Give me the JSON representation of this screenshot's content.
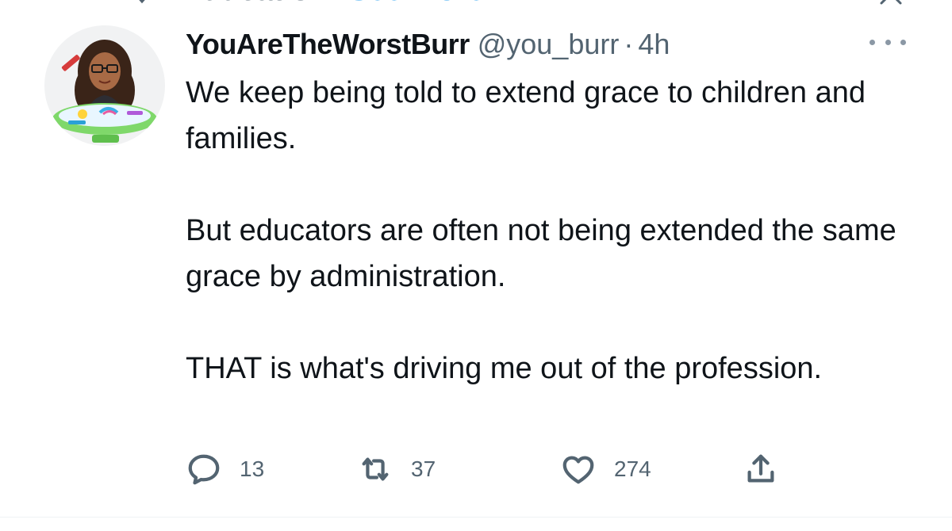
{
  "context": {
    "label": "Education",
    "link": "See more",
    "icon": "topic-icon",
    "dismiss_icon": "close-icon"
  },
  "tweet": {
    "author": {
      "display_name": "YouAreTheWorstBurr",
      "handle": "@you_burr",
      "avatar": "bitmoji-avatar"
    },
    "separator": "·",
    "timestamp": "4h",
    "more_icon": "more-icon",
    "text": [
      "We keep being told to extend grace to children and families.",
      "But educators are often not being extended the same grace by administration.",
      "THAT is what's driving me out of the profession."
    ],
    "actions": {
      "reply": {
        "icon": "reply-icon",
        "count": "13"
      },
      "retweet": {
        "icon": "retweet-icon",
        "count": "37"
      },
      "like": {
        "icon": "heart-icon",
        "count": "274"
      },
      "share": {
        "icon": "share-icon"
      }
    }
  },
  "colors": {
    "text": "#0f1419",
    "secondary": "#536471",
    "link": "#1d9bf0",
    "background": "#ffffff"
  }
}
